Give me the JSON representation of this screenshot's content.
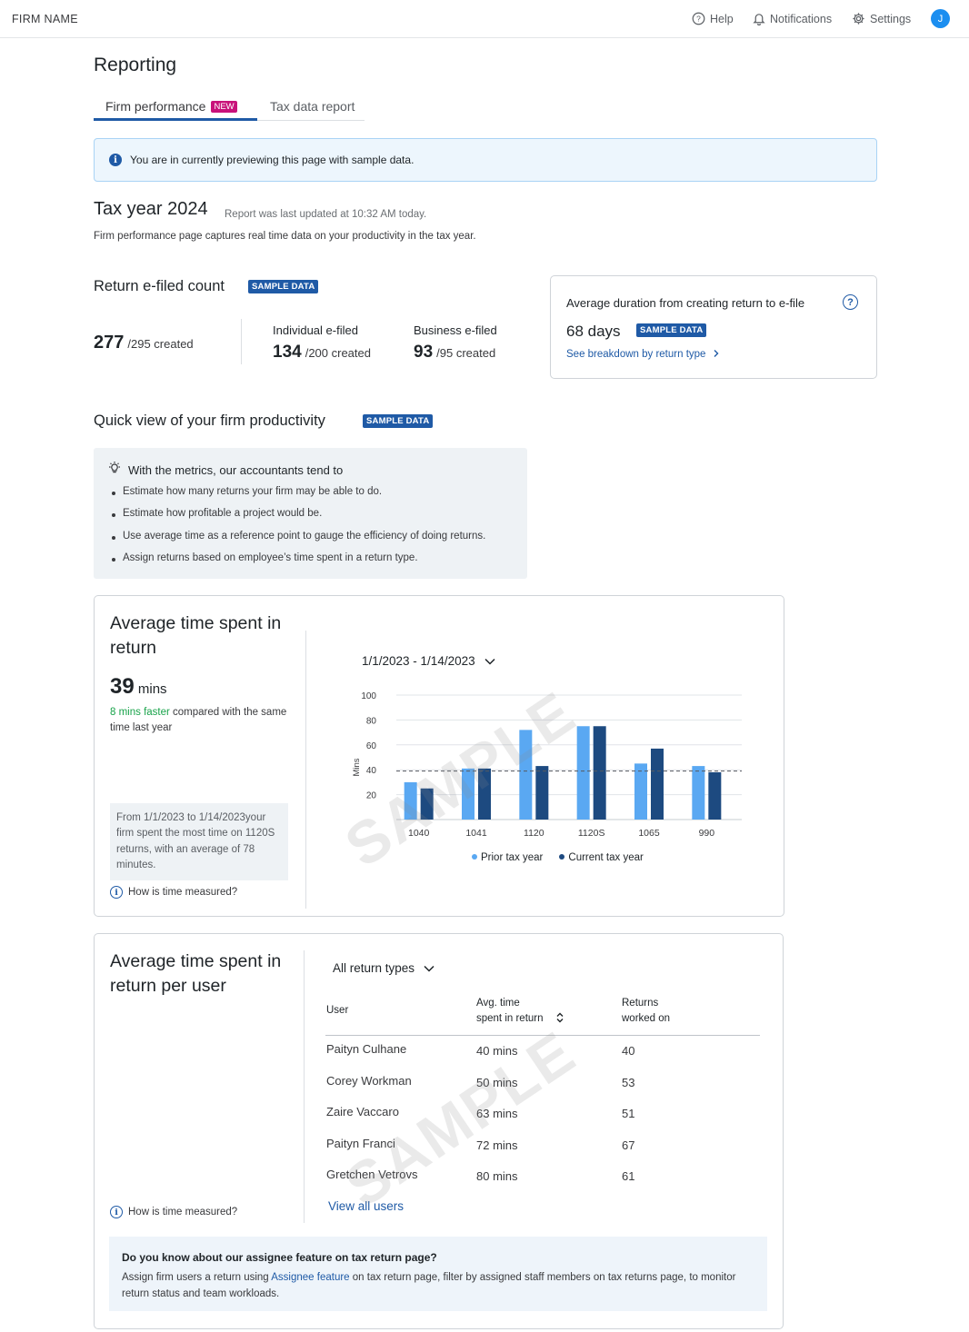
{
  "header": {
    "firm_name": "FIRM NAME",
    "help": "Help",
    "notifications": "Notifications",
    "settings": "Settings",
    "avatar_initial": "J"
  },
  "page": {
    "title": "Reporting",
    "tabs": [
      {
        "label": "Firm performance",
        "badge": "NEW",
        "active": true
      },
      {
        "label": "Tax data report",
        "active": false
      }
    ]
  },
  "banner": {
    "icon": "info-icon",
    "text": "You are in currently previewing this page with sample data."
  },
  "tax_year": {
    "title": "Tax year 2024",
    "updated": "Report was last updated at 10:32 AM today.",
    "description": "Firm performance page captures real time data on your productivity in the tax year."
  },
  "efiled": {
    "heading": "Return e-filed count",
    "badge": "SAMPLE DATA",
    "total": {
      "value": "277",
      "created": "/295 created"
    },
    "individual": {
      "label": "Individual e-filed",
      "value": "134",
      "created": "/200 created"
    },
    "business": {
      "label": "Business e-filed",
      "value": "93",
      "created": "/95 created"
    }
  },
  "duration": {
    "title": "Average duration from creating return to e-file",
    "value": "68 days",
    "badge": "SAMPLE DATA",
    "link": "See breakdown by return type"
  },
  "productivity": {
    "heading": "Quick view of your firm productivity",
    "badge": "SAMPLE DATA",
    "tips_title": "With the metrics, our accountants tend to",
    "tips": [
      "Estimate how many returns your firm may be able to do.",
      "Estimate how profitable a project would be.",
      "Use average time as a reference point to gauge the efficiency of doing returns.",
      "Assign returns based on employee’s time spent in a return type."
    ]
  },
  "avg_time": {
    "title": "Average time spent in return",
    "value": "39",
    "unit": "mins",
    "faster_highlight": "8 mins faster",
    "faster_rest": " compared with the same time last year",
    "note": "From 1/1/2023 to 1/14/2023your firm spent the most time on 1120S returns, with an average of 78 minutes.",
    "how_link": "How is time measured?",
    "date_range": "1/1/2023 - 1/14/2023",
    "watermark": "SAMPLE"
  },
  "chart_data": {
    "type": "bar",
    "title": "",
    "xlabel": "",
    "ylabel": "Mins",
    "ylim": [
      0,
      100
    ],
    "yticks": [
      20,
      40,
      60,
      80,
      100
    ],
    "categories": [
      "1040",
      "1041",
      "1120",
      "1120S",
      "1065",
      "990"
    ],
    "series": [
      {
        "name": "Prior tax year",
        "color": "#5aa8f2",
        "values": [
          30,
          41,
          72,
          75,
          45,
          43
        ]
      },
      {
        "name": "Current tax year",
        "color": "#1d4a80",
        "values": [
          25,
          41,
          43,
          75,
          57,
          38
        ]
      }
    ],
    "reference_line": 39,
    "legend_position": "bottom",
    "grid": true
  },
  "per_user": {
    "title": "Average time spent in return per user",
    "filter": "All return types",
    "columns": {
      "user": "User",
      "avg_line1": "Avg. time",
      "avg_line2": "spent in return",
      "returns_line1": "Returns",
      "returns_line2": "worked on"
    },
    "rows": [
      {
        "user": "Paityn Culhane",
        "avg": "40 mins",
        "returns": "40"
      },
      {
        "user": "Corey Workman",
        "avg": "50 mins",
        "returns": "53"
      },
      {
        "user": "Zaire Vaccaro",
        "avg": "63 mins",
        "returns": "51"
      },
      {
        "user": "Paityn Franci",
        "avg": "72 mins",
        "returns": "67"
      },
      {
        "user": "Gretchen Vetrovs",
        "avg": "80 mins",
        "returns": "61"
      }
    ],
    "view_all": "View all users",
    "how_link": "How is time measured?",
    "watermark": "SAMPLE",
    "promo_title": "Do you know about our assignee feature on tax return page?",
    "promo_pre": "Assign firm users a return using ",
    "promo_link": "Assignee feature",
    "promo_post": " on tax return page, filter by assigned staff members on tax returns page, to monitor return status and team workloads."
  }
}
